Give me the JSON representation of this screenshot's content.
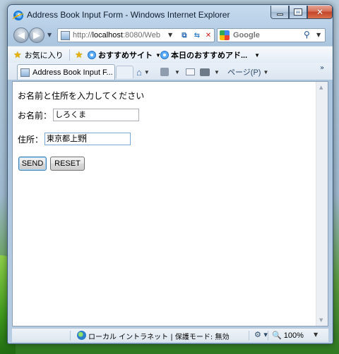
{
  "window": {
    "title": "Address Book Input Form - Windows Internet Explorer"
  },
  "address_bar": {
    "url_prefix": "http://",
    "url_host": "localhost",
    "url_rest": ":8080/Web"
  },
  "search": {
    "label": "Google"
  },
  "favorites_bar": {
    "favorites_label": "お気に入り",
    "items": [
      {
        "label": "おすすめサイト"
      },
      {
        "label": "本日のおすすめアド..."
      }
    ]
  },
  "tabs": [
    {
      "label": "Address Book Input F..."
    }
  ],
  "command_bar": {
    "page_menu_label": "ページ(P)"
  },
  "page": {
    "heading": "お名前と住所を入力してください",
    "name_label": "お名前：",
    "name_value": "しろくま",
    "address_label": "住所：",
    "address_value": "東京都上野",
    "send_label": "SEND",
    "reset_label": "RESET"
  },
  "status_bar": {
    "zone_text": "ローカル イントラネット | 保護モード: 無効",
    "zoom": "100%"
  },
  "icons": [
    "ie-logo-icon",
    "minimize-icon",
    "maximize-icon",
    "close-icon",
    "back-icon",
    "forward-icon",
    "compat-view-icon",
    "refresh-icon",
    "stop-icon",
    "google-icon",
    "search-icon",
    "favorites-star-icon",
    "add-favorites-icon",
    "home-icon",
    "feeds-icon",
    "mail-icon",
    "print-icon",
    "globe-icon",
    "zoom-icon"
  ]
}
